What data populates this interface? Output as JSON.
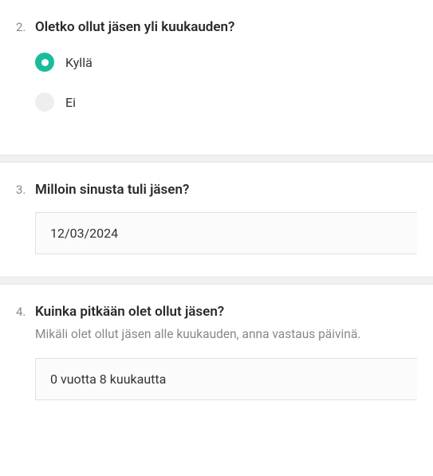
{
  "questions": [
    {
      "number": "2.",
      "title": "Oletko ollut jäsen yli kuukauden?",
      "options": [
        {
          "label": "Kyllä",
          "selected": true
        },
        {
          "label": "Ei",
          "selected": false
        }
      ]
    },
    {
      "number": "3.",
      "title": "Milloin sinusta tuli jäsen?",
      "value": "12/03/2024"
    },
    {
      "number": "4.",
      "title": "Kuinka pitkään olet ollut jäsen?",
      "subtitle": "Mikäli olet ollut jäsen alle kuukauden, anna vastaus päivinä.",
      "value": "0 vuotta 8 kuukautta"
    }
  ]
}
